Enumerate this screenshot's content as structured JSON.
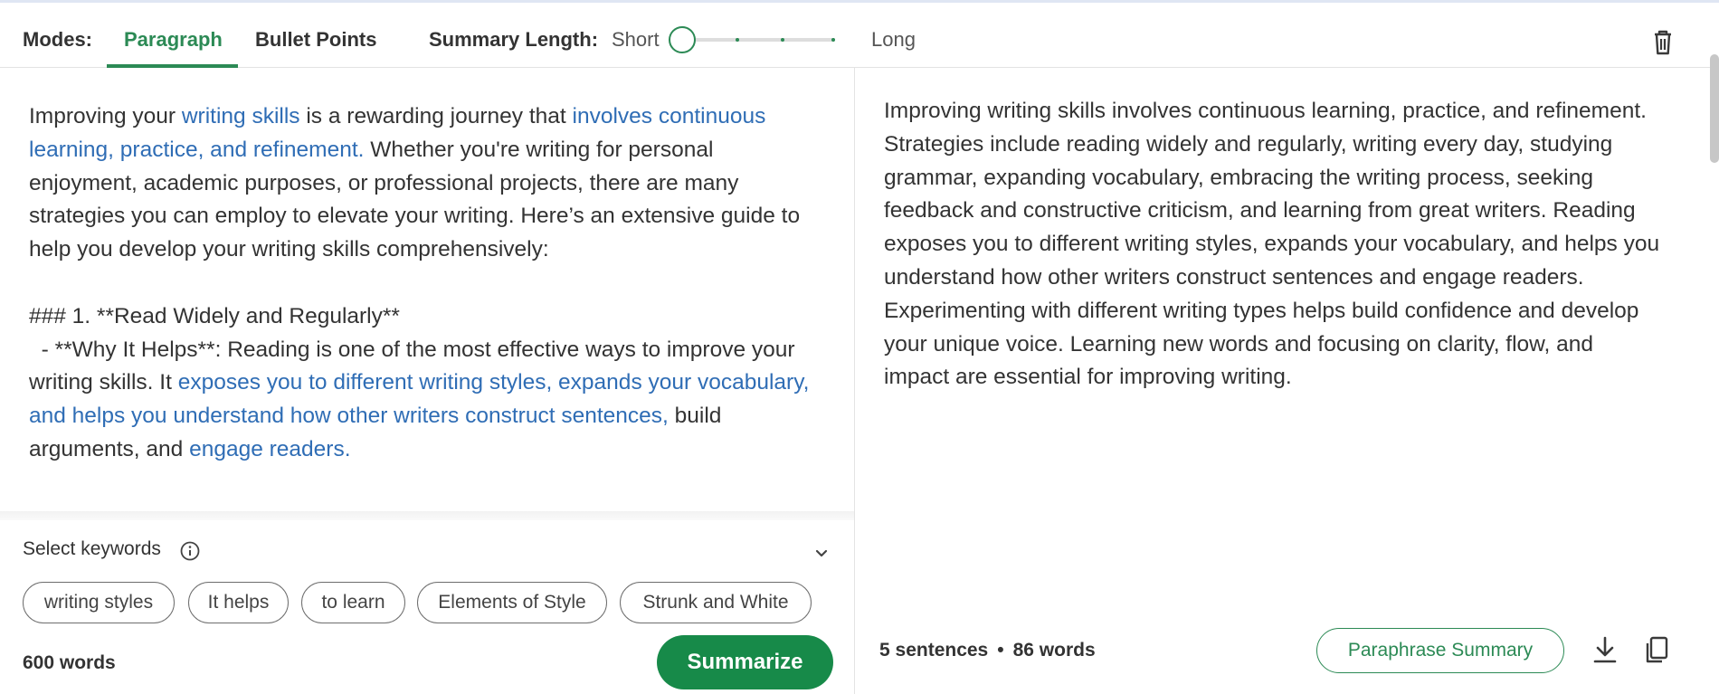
{
  "toolbar": {
    "modes_label": "Modes:",
    "tabs": [
      "Paragraph",
      "Bullet Points"
    ],
    "active_tab": "Paragraph",
    "summary_length_label": "Summary Length:",
    "short_label": "Short",
    "long_label": "Long",
    "summary_length_level": 0
  },
  "input": {
    "segments": [
      {
        "t": "Improving your "
      },
      {
        "t": "writing skills",
        "hl": true
      },
      {
        "t": " is a rewarding journey that "
      },
      {
        "t": "involves continuous learning, practice, and refinement.",
        "hl": true
      },
      {
        "t": " Whether you're writing for personal enjoyment, academic purposes, or professional projects, there are many strategies you can employ to elevate your writing. Here’s an extensive guide to help you develop your writing skills comprehensively:\n\n### 1. **Read Widely and Regularly**\n  - **Why It Helps**: Reading is one of the most effective ways to improve your writing skills. It "
      },
      {
        "t": "exposes you to different writing styles, expands your vocabulary, and helps you understand how other writers construct sentences,",
        "hl": true
      },
      {
        "t": " build arguments, and "
      },
      {
        "t": "engage readers.",
        "hl": true
      }
    ]
  },
  "keywords": {
    "label": "Select keywords",
    "chips": [
      "writing styles",
      "It helps",
      "to learn",
      "Elements of Style",
      "Strunk and White"
    ]
  },
  "footer_left": {
    "word_count": "600 words",
    "summarize_label": "Summarize"
  },
  "output": {
    "text": "Improving writing skills involves continuous learning, practice, and refinement. Strategies include reading widely and regularly, writing every day, studying grammar, expanding vocabulary, embracing the writing process, seeking feedback and constructive criticism, and learning from great writers. Reading exposes you to different writing styles, expands your vocabulary, and helps you understand how other writers construct sentences and engage readers. Experimenting with different writing types helps build confidence and develop your unique voice. Learning new words and focusing on clarity, flow, and impact are essential for improving writing."
  },
  "footer_right": {
    "sentences": "5 sentences",
    "separator": "•",
    "words": "86 words",
    "paraphrase_label": "Paraphrase Summary"
  },
  "icons": [
    "trash-icon",
    "info-icon",
    "chevron-down-icon",
    "download-icon",
    "copy-icon"
  ],
  "colors": {
    "accent": "#2c8a55",
    "button": "#178a49",
    "highlight": "#2f6db5"
  }
}
